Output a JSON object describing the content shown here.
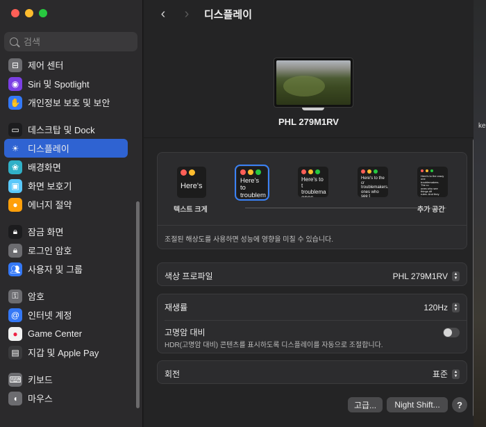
{
  "window": {
    "title": "디스플레이"
  },
  "traffic_lights": {
    "close": "#ff5f57",
    "minimize": "#febc2e",
    "zoom": "#28c840"
  },
  "search": {
    "placeholder": "검색"
  },
  "sidebar": {
    "items": [
      {
        "label": "제어 센터",
        "icon": "control-center-icon",
        "color": "#6c6c70"
      },
      {
        "label": "Siri 및 Spotlight",
        "icon": "siri-icon",
        "color": "#7b3fe4"
      },
      {
        "label": "개인정보 보호 및 보안",
        "icon": "hand-icon",
        "color": "#3478f6"
      },
      {
        "label": "데스크탑 및 Dock",
        "icon": "dock-icon",
        "color": "#1c1c1e"
      },
      {
        "label": "디스플레이",
        "icon": "brightness-icon",
        "color": "#2f63d2"
      },
      {
        "label": "배경화면",
        "icon": "wallpaper-icon",
        "color": "#30b0c7"
      },
      {
        "label": "화면 보호기",
        "icon": "screensaver-icon",
        "color": "#5ac8fa"
      },
      {
        "label": "에너지 절약",
        "icon": "lightbulb-icon",
        "color": "#ff9f0a"
      },
      {
        "label": "잠금 화면",
        "icon": "lock-screen-icon",
        "color": "#1c1c1e"
      },
      {
        "label": "로그인 암호",
        "icon": "lock-icon",
        "color": "#6c6c70"
      },
      {
        "label": "사용자 및 그룹",
        "icon": "users-icon",
        "color": "#3478f6"
      },
      {
        "label": "암호",
        "icon": "key-icon",
        "color": "#6c6c70"
      },
      {
        "label": "인터넷 계정",
        "icon": "at-icon",
        "color": "#3478f6"
      },
      {
        "label": "Game Center",
        "icon": "game-center-icon",
        "color": "#f2f2f2"
      },
      {
        "label": "지갑 및 Apple Pay",
        "icon": "wallet-icon",
        "color": "#3a3a3c"
      },
      {
        "label": "키보드",
        "icon": "keyboard-icon",
        "color": "#6c6c70"
      },
      {
        "label": "마우스",
        "icon": "mouse-icon",
        "color": "#6c6c70"
      }
    ],
    "active_index": 4
  },
  "display": {
    "name": "PHL 279M1RV",
    "resolution": {
      "options": [
        {
          "text": "Here's",
          "size": "large"
        },
        {
          "text": "Here's to\ntroublem",
          "size": "medium",
          "selected": true
        },
        {
          "text": "Here's to t\ntroublema\nones who",
          "size": "small"
        },
        {
          "text": "Here's to the cr\ntroublemakers.\nones who see t\nrules. And they",
          "size": "smaller"
        },
        {
          "text": "Here's to the crazy one\ntroublemakers. The ro\nones who see things dif\nrules. And they have n\ncan quote them, disagre\nthem. About the only thi\nBecause they change t",
          "size": "smallest"
        }
      ],
      "left_label": "텍스트 크게",
      "right_label": "추가 공간",
      "note": "조절된 해상도를 사용하면 성능에 영향을 미칠 수 있습니다."
    },
    "color_profile": {
      "label": "색상 프로파일",
      "value": "PHL 279M1RV"
    },
    "refresh_rate": {
      "label": "재생률",
      "value": "120Hz"
    },
    "hdr": {
      "label": "고명암 대비",
      "description": "HDR(고명암 대비) 콘텐츠를 표시하도록 디스플레이를 자동으로 조절합니다.",
      "enabled": false
    },
    "rotation": {
      "label": "회전",
      "value": "표준"
    }
  },
  "buttons": {
    "advanced": "고급...",
    "night_shift": "Night Shift...",
    "help": "?"
  },
  "desktop_label": "ke"
}
